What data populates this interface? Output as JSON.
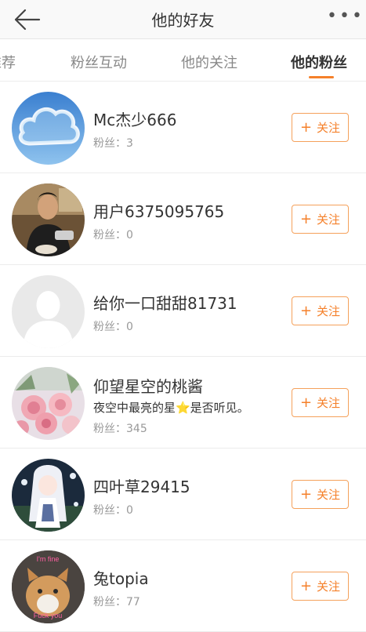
{
  "header": {
    "title": "他的好友"
  },
  "tabs": [
    {
      "label": "推荐"
    },
    {
      "label": "粉丝互动"
    },
    {
      "label": "他的关注"
    },
    {
      "label": "他的粉丝"
    }
  ],
  "accent_color": "#f5802a",
  "follow_label": "关注",
  "users": [
    {
      "name": "Mc杰少666",
      "fans": "粉丝：3",
      "desc": ""
    },
    {
      "name": "用户6375095765",
      "fans": "粉丝：0",
      "desc": ""
    },
    {
      "name": "给你一口甜甜81731",
      "fans": "粉丝：0",
      "desc": ""
    },
    {
      "name": "仰望星空的桃酱",
      "fans": "粉丝：345",
      "desc": "夜空中最亮的星⭐是否听见。"
    },
    {
      "name": "四叶草29415",
      "fans": "粉丝：0",
      "desc": ""
    },
    {
      "name": "兔topia",
      "fans": "粉丝：77",
      "desc": ""
    }
  ],
  "avatar_texts": {
    "cat_top": "I'm fine",
    "cat_bottom": "Fuck you"
  }
}
